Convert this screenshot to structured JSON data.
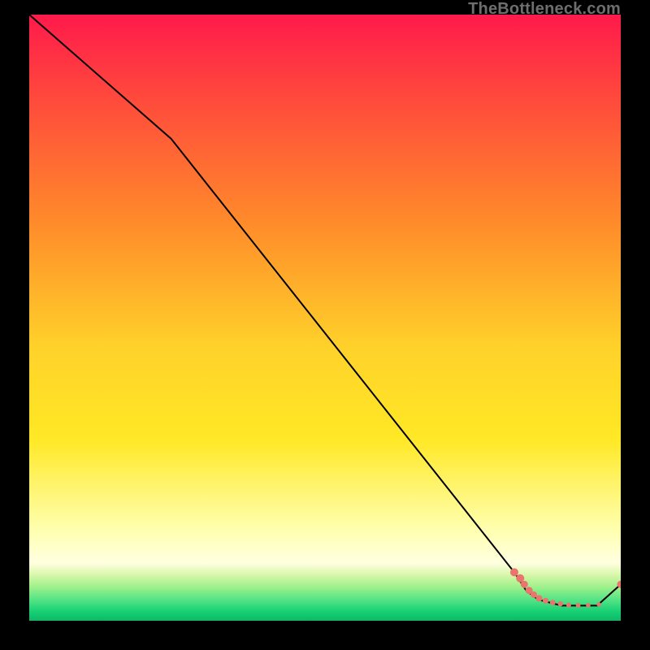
{
  "watermark": "TheBottleneck.com",
  "colors": {
    "bg": "#000000",
    "line": "#000000",
    "marker": "#e9766d",
    "grad_top": "#ff1a4b",
    "grad_mid_upper": "#ff8a2a",
    "grad_mid": "#ffe825",
    "grad_low": "#ffffb0",
    "grad_green1": "#9cf08a",
    "grad_green2": "#2fe07a",
    "grad_green3": "#10c96a"
  },
  "chart_data": {
    "type": "line",
    "title": "",
    "xlabel": "",
    "ylabel": "",
    "xlim": [
      0,
      100
    ],
    "ylim": [
      0,
      100
    ],
    "line_points": [
      {
        "x": 0,
        "y": 100
      },
      {
        "x": 24,
        "y": 79.5
      },
      {
        "x": 82,
        "y": 8
      },
      {
        "x": 84,
        "y": 5
      },
      {
        "x": 86,
        "y": 3.5
      },
      {
        "x": 90,
        "y": 2.5
      },
      {
        "x": 96,
        "y": 2.5
      },
      {
        "x": 100,
        "y": 6
      }
    ],
    "markers": [
      {
        "x": 82,
        "y": 8,
        "r": 5
      },
      {
        "x": 83,
        "y": 7,
        "r": 5
      },
      {
        "x": 83.7,
        "y": 6,
        "r": 4.5
      },
      {
        "x": 84.5,
        "y": 5,
        "r": 4.5
      },
      {
        "x": 85.3,
        "y": 4.3,
        "r": 4
      },
      {
        "x": 86.2,
        "y": 3.7,
        "r": 4
      },
      {
        "x": 87.3,
        "y": 3.3,
        "r": 3.6
      },
      {
        "x": 88.5,
        "y": 3,
        "r": 3.4
      },
      {
        "x": 89.8,
        "y": 2.8,
        "r": 3.2
      },
      {
        "x": 91.2,
        "y": 2.6,
        "r": 3
      },
      {
        "x": 92.8,
        "y": 2.55,
        "r": 2.9
      },
      {
        "x": 94.5,
        "y": 2.55,
        "r": 2.8
      },
      {
        "x": 96.3,
        "y": 2.7,
        "r": 2.7
      },
      {
        "x": 100,
        "y": 6,
        "r": 4.5
      }
    ],
    "gradient_stops": [
      {
        "offset": 0,
        "color": "#ff1a4b"
      },
      {
        "offset": 0.14,
        "color": "#ff4a3c"
      },
      {
        "offset": 0.34,
        "color": "#ff8a2a"
      },
      {
        "offset": 0.55,
        "color": "#ffd22a"
      },
      {
        "offset": 0.7,
        "color": "#ffe825"
      },
      {
        "offset": 0.85,
        "color": "#ffffb0"
      },
      {
        "offset": 0.905,
        "color": "#ffffe0"
      },
      {
        "offset": 0.925,
        "color": "#d6f7a8"
      },
      {
        "offset": 0.945,
        "color": "#9cf08a"
      },
      {
        "offset": 0.965,
        "color": "#55e486"
      },
      {
        "offset": 0.985,
        "color": "#16d074"
      },
      {
        "offset": 1.0,
        "color": "#0fb765"
      }
    ]
  }
}
